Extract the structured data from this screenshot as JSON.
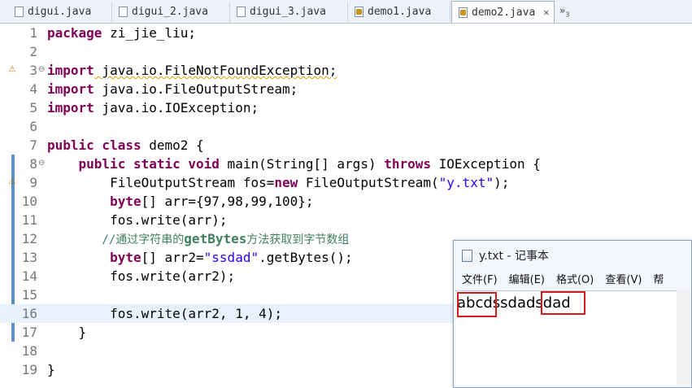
{
  "tabs": [
    {
      "label": "digui.java"
    },
    {
      "label": "digui_2.java"
    },
    {
      "label": "digui_3.java"
    },
    {
      "label": "demo1.java"
    },
    {
      "label": "demo2.java",
      "close": "✕"
    }
  ],
  "tab_overflow": {
    "symbol": "»",
    "count": "3"
  },
  "editor": {
    "lines": [
      {
        "n": "1",
        "t1": "package",
        "t2": " zi_jie_liu;"
      },
      {
        "n": "2"
      },
      {
        "n": "3",
        "t1": "import",
        "t2": " java.io.FileNotFoundException;"
      },
      {
        "n": "4",
        "t1": "import",
        "t2": " java.io.FileOutputStream;"
      },
      {
        "n": "5",
        "t1": "import",
        "t2": " java.io.IOException;"
      },
      {
        "n": "6"
      },
      {
        "n": "7",
        "t1": "public class",
        "t2": " demo2 {"
      },
      {
        "n": "8",
        "t1": "    public static void",
        "t2": " main(String[] args) ",
        "t3": "throws",
        "t4": " IOException {"
      },
      {
        "n": "9",
        "t1": "        FileOutputStream fos=",
        "t2": "new",
        "t3": " FileOutputStream(",
        "t4": "\"y.txt\"",
        "t5": ");"
      },
      {
        "n": "10",
        "t1": "        byte",
        "t2": "[] arr={97,98,99,100};"
      },
      {
        "n": "11",
        "t1": "        fos.write(arr);"
      },
      {
        "n": "12",
        "t1": "        //通过字符串的",
        "t2": "getBytes",
        "t3": "方法获取到字节数组"
      },
      {
        "n": "13",
        "t1": "        byte",
        "t2": "[] arr2=",
        "t3": "\"ssdad\"",
        "t4": ".getBytes();"
      },
      {
        "n": "14",
        "t1": "        fos.write(arr2);"
      },
      {
        "n": "15"
      },
      {
        "n": "16",
        "t1": "        fos.write(arr2, 1, 4);"
      },
      {
        "n": "17",
        "t1": "    }"
      },
      {
        "n": "18"
      },
      {
        "n": "19",
        "t1": "}"
      }
    ]
  },
  "notepad": {
    "title": "y.txt - 记事本",
    "menu": [
      "文件(F)",
      "编辑(E)",
      "格式(O)",
      "查看(V)",
      "帮"
    ],
    "content": "abcdssdadsdad"
  }
}
